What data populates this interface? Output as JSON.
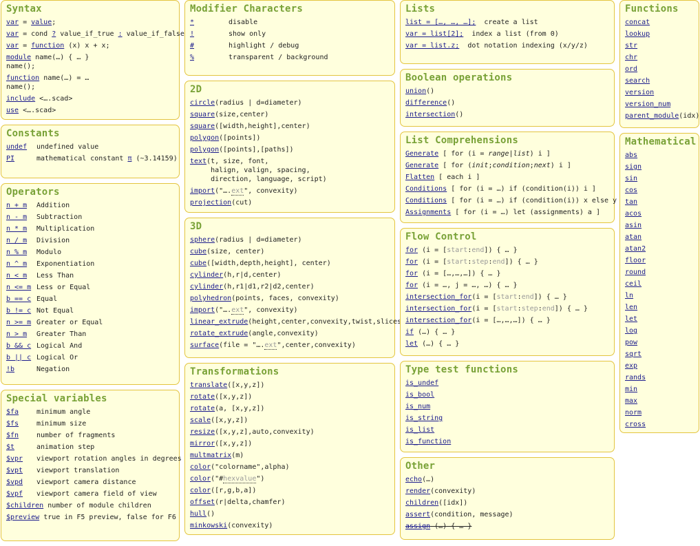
{
  "syntax": {
    "title": "Syntax",
    "rows": [
      {
        "a1": "var",
        "t1": " = ",
        "a2": "value",
        "t2": ";"
      },
      {
        "a1": "var",
        "t1": " = cond ",
        "a2": "?",
        "t2": " value_if_true ",
        "a3": ":",
        "t3": " value_if_false;"
      },
      {
        "a1": "var",
        "t1": " = ",
        "a2": "function",
        "t2": " (x) x + x;"
      },
      {
        "a1": "module",
        "t1": " name(…) { … }",
        "line2": "name();"
      },
      {
        "a1": "function",
        "t1": " name(…) = …",
        "line2": "name();"
      },
      {
        "a1": "include",
        "t1": " <….scad>"
      },
      {
        "a1": "use",
        "t1": " <….scad>"
      }
    ]
  },
  "constants": {
    "title": "Constants",
    "rows": [
      {
        "key": "undef",
        "desc": "undefined value"
      },
      {
        "key": "PI",
        "desc_pre": "mathematical constant ",
        "link": "π",
        "desc_post": " (~3.14159)"
      }
    ]
  },
  "operators": {
    "title": "Operators",
    "rows": [
      {
        "key": "n + m",
        "desc": "Addition"
      },
      {
        "key": "n - m",
        "desc": "Subtraction"
      },
      {
        "key": "n * m",
        "desc": "Multiplication"
      },
      {
        "key": "n / m",
        "desc": "Division"
      },
      {
        "key": "n % m",
        "desc": "Modulo"
      },
      {
        "key": "n ^ m",
        "desc": "Exponentiation"
      },
      {
        "key": "n < m",
        "desc": "Less Than"
      },
      {
        "key": "n <= m",
        "desc": "Less or Equal"
      },
      {
        "key": "b == c",
        "desc": "Equal"
      },
      {
        "key": "b != c",
        "desc": "Not Equal"
      },
      {
        "key": "n >= m",
        "desc": "Greater or Equal"
      },
      {
        "key": "n > m",
        "desc": "Greater Than"
      },
      {
        "key": "b && c",
        "desc": "Logical And"
      },
      {
        "key": "b || c",
        "desc": "Logical Or"
      },
      {
        "key": "!b",
        "desc": "Negation"
      }
    ]
  },
  "special": {
    "title": "Special variables",
    "rows": [
      {
        "key": "$fa",
        "desc": "minimum angle"
      },
      {
        "key": "$fs",
        "desc": "minimum size"
      },
      {
        "key": "$fn",
        "desc": "number of fragments"
      },
      {
        "key": "$t",
        "desc": "animation step"
      },
      {
        "key": "$vpr",
        "desc": "viewport rotation angles in degrees"
      },
      {
        "key": "$vpt",
        "desc": "viewport translation"
      },
      {
        "key": "$vpd",
        "desc": "viewport camera distance"
      },
      {
        "key": "$vpf",
        "desc": "viewport camera field of view"
      },
      {
        "key": "$children",
        "desc": " number of module children"
      },
      {
        "key": "$preview",
        "desc": " true in F5 preview, false for F6"
      }
    ]
  },
  "modifiers": {
    "title": "Modifier Characters",
    "rows": [
      {
        "key": "*",
        "desc": "disable"
      },
      {
        "key": "!",
        "desc": "show only"
      },
      {
        "key": "#",
        "desc": "highlight / debug"
      },
      {
        "key": "%",
        "desc": "transparent / background"
      }
    ]
  },
  "twod": {
    "title": "2D",
    "rows": [
      {
        "fn": "circle",
        "args": "(radius | d=diameter)"
      },
      {
        "fn": "square",
        "args": "(size,center)"
      },
      {
        "fn": "square",
        "args": "([width,height],center)"
      },
      {
        "fn": "polygon",
        "args": "([points])"
      },
      {
        "fn": "polygon",
        "args": "([points],[paths])"
      },
      {
        "fn": "text",
        "args": "(t, size, font,\n     halign, valign, spacing,\n     direction, language, script)"
      },
      {
        "fn": "import",
        "args_pre": "(\"….",
        "dim": "ext",
        "args_post": "\", convexity)"
      },
      {
        "fn": "projection",
        "args": "(cut)"
      }
    ]
  },
  "threed": {
    "title": "3D",
    "rows": [
      {
        "fn": "sphere",
        "args": "(radius | d=diameter)"
      },
      {
        "fn": "cube",
        "args": "(size, center)"
      },
      {
        "fn": "cube",
        "args": "([width,depth,height], center)"
      },
      {
        "fn": "cylinder",
        "args": "(h,r|d,center)"
      },
      {
        "fn": "cylinder",
        "args": "(h,r1|d1,r2|d2,center)"
      },
      {
        "fn": "polyhedron",
        "args": "(points, faces, convexity)"
      },
      {
        "fn": "import",
        "args_pre": "(\"….",
        "dim": "ext",
        "args_post": "\", convexity)"
      },
      {
        "fn": "linear_extrude",
        "args": "(height,center,convexity,twist,slices)"
      },
      {
        "fn": "rotate_extrude",
        "args": "(angle,convexity)"
      },
      {
        "fn": "surface",
        "args_pre": "(file = \"….",
        "dim": "ext",
        "args_post": "\",center,convexity)"
      }
    ]
  },
  "transformations": {
    "title": "Transformations",
    "rows": [
      {
        "fn": "translate",
        "args": "([x,y,z])"
      },
      {
        "fn": "rotate",
        "args": "([x,y,z])"
      },
      {
        "fn": "rotate",
        "args": "(a, [x,y,z])"
      },
      {
        "fn": "scale",
        "args": "([x,y,z])"
      },
      {
        "fn": "resize",
        "args": "([x,y,z],auto,convexity)"
      },
      {
        "fn": "mirror",
        "args": "([x,y,z])"
      },
      {
        "fn": "multmatrix",
        "args": "(m)"
      },
      {
        "fn": "color",
        "args": "(\"colorname\",alpha)"
      },
      {
        "fn": "color",
        "args_pre": "(\"#",
        "dim": "hexvalue",
        "args_post": "\")"
      },
      {
        "fn": "color",
        "args": "([r,g,b,a])"
      },
      {
        "fn": "offset",
        "args": "(r|delta,chamfer)"
      },
      {
        "fn": "hull",
        "args": "()"
      },
      {
        "fn": "minkowski",
        "args": "(convexity)"
      }
    ]
  },
  "lists": {
    "title": "Lists",
    "rows": [
      {
        "fn": "list = […, …, …];",
        "args": "  create a list"
      },
      {
        "fn": "var = list[2];",
        "args": "  index a list (from 0)"
      },
      {
        "fn": "var = list.z;",
        "args": "  dot notation indexing (x/y/z)"
      }
    ]
  },
  "boolean": {
    "title": "Boolean operations",
    "rows": [
      {
        "fn": "union",
        "args": "()"
      },
      {
        "fn": "difference",
        "args": "()"
      },
      {
        "fn": "intersection",
        "args": "()"
      }
    ]
  },
  "listcomp": {
    "title": "List Comprehensions",
    "rows": [
      {
        "fn": "Generate",
        "p1": " [ for (i = ",
        "i1": "range",
        "p2": "|",
        "i2": "list",
        "p3": ") i ]"
      },
      {
        "fn": "Generate",
        "p1": " [ for (",
        "i1": "init",
        "p2": ";",
        "i2": "condition",
        "p3": ";",
        "i3": "next",
        "p4": ") i ]"
      },
      {
        "fn": "Flatten",
        "p1": " [ each i ]"
      },
      {
        "fn": "Conditions",
        "p1": " [ for (i = …) if (condition(i)) i ]"
      },
      {
        "fn": "Conditions",
        "p1": " [ for (i = …) if (condition(i)) x else y ]"
      },
      {
        "fn": "Assignments",
        "p1": " [ for (i = …) let (assignments) a ]"
      }
    ]
  },
  "flow": {
    "title": "Flow Control",
    "rows": [
      {
        "fn": "for",
        "p1": " (i = [",
        "d1": "start",
        "p2": ":",
        "d2": "end",
        "p3": "]) { … }"
      },
      {
        "fn": "for",
        "p1": " (i = [",
        "d1": "start",
        "p2": ":",
        "d2": "step",
        "p3": ":",
        "d3": "end",
        "p4": "]) { … }"
      },
      {
        "fn": "for",
        "p1": " (i = […,…,…]) { … }"
      },
      {
        "fn": "for",
        "p1": " (i = …, j = …, …) { … }"
      },
      {
        "fn": "intersection_for",
        "p1": "(i = [",
        "d1": "start",
        "p2": ":",
        "d2": "end",
        "p3": "]) { … }"
      },
      {
        "fn": "intersection_for",
        "p1": "(i = [",
        "d1": "start",
        "p2": ":",
        "d2": "step",
        "p3": ":",
        "d3": "end",
        "p4": "]) { … }"
      },
      {
        "fn": "intersection_for",
        "p1": "(i = […,…,…]) { … }"
      },
      {
        "fn": "if",
        "p1": " (…) { … }"
      },
      {
        "fn": "let",
        "p1": " (…) { … }"
      }
    ]
  },
  "typetest": {
    "title": "Type test functions",
    "rows": [
      "is_undef",
      "is_bool",
      "is_num",
      "is_string",
      "is_list",
      "is_function"
    ]
  },
  "other": {
    "title": "Other",
    "rows": [
      {
        "fn": "echo",
        "args": "(…)"
      },
      {
        "fn": "render",
        "args": "(convexity)"
      },
      {
        "fn": "children",
        "args": "([idx])"
      },
      {
        "fn": "assert",
        "args": "(condition, message)"
      },
      {
        "fn": "assign",
        "args": " (…) { … }",
        "deprecated": true
      }
    ]
  },
  "functions": {
    "title": "Functions",
    "rows": [
      {
        "fn": "concat"
      },
      {
        "fn": "lookup"
      },
      {
        "fn": "str"
      },
      {
        "fn": "chr"
      },
      {
        "fn": "ord"
      },
      {
        "fn": "search"
      },
      {
        "fn": "version"
      },
      {
        "fn": "version_num"
      },
      {
        "fn": "parent_module",
        "args": "(idx)"
      }
    ]
  },
  "math": {
    "title": "Mathematical",
    "rows": [
      "abs",
      "sign",
      "sin",
      "cos",
      "tan",
      "acos",
      "asin",
      "atan",
      "atan2",
      "floor",
      "round",
      "ceil",
      "ln",
      "len",
      "let",
      "log",
      "pow",
      "sqrt",
      "exp",
      "rands",
      "min",
      "max",
      "norm",
      "cross"
    ]
  }
}
